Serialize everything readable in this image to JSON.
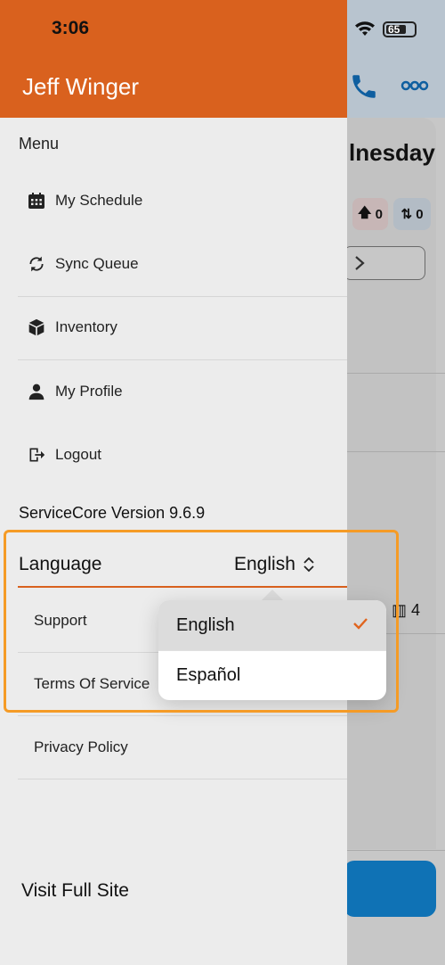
{
  "status_bar": {
    "time": "3:06",
    "battery_level": "65"
  },
  "background": {
    "day_fragment": "lnesday",
    "upload_count": "0",
    "sync_count": "0",
    "item_count": "4"
  },
  "drawer": {
    "user_name": "Jeff Winger",
    "menu_title": "Menu",
    "items": [
      {
        "label": "My Schedule",
        "icon": "calendar-icon"
      },
      {
        "label": "Sync Queue",
        "icon": "sync-icon"
      },
      {
        "label": "Inventory",
        "icon": "box-icon"
      },
      {
        "label": "My Profile",
        "icon": "user-icon"
      },
      {
        "label": "Logout",
        "icon": "logout-icon"
      }
    ],
    "version_text": "ServiceCore Version 9.6.9",
    "language": {
      "label": "Language",
      "value": "English"
    },
    "links": [
      "Support",
      "Terms Of Service",
      "Privacy Policy"
    ],
    "visit_full_site": "Visit Full Site"
  },
  "language_dropdown": {
    "options": [
      "English",
      "Español"
    ],
    "selected": "English"
  },
  "colors": {
    "accent": "#d9611e",
    "highlight": "#f59b26",
    "primary_blue": "#0f72b5"
  }
}
